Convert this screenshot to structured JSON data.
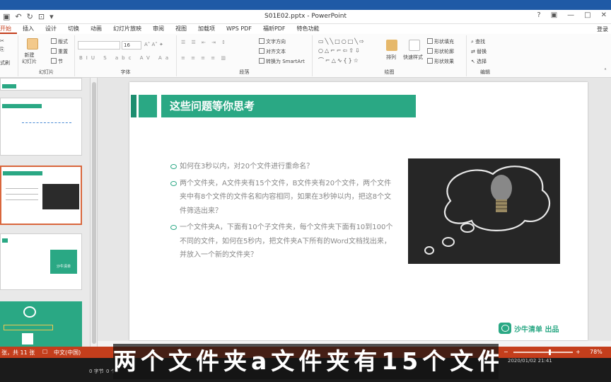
{
  "window": {
    "title": "S01E02.pptx - PowerPoint",
    "login_label": "登录"
  },
  "tabs": [
    "开始",
    "插入",
    "设计",
    "切换",
    "动画",
    "幻灯片放映",
    "审阅",
    "视图",
    "加载项",
    "WPS PDF",
    "福昕PDF",
    "特色功能"
  ],
  "ribbon": {
    "clipboard": {
      "cut": "剪切",
      "copy": "复制",
      "format": "格式刷"
    },
    "slides_group_label": "幻灯片",
    "new_slide_label": "新建\n幻灯片",
    "layout": "版式",
    "reset": "重置",
    "section": "节",
    "font_group_label": "字体",
    "font_size": "16",
    "para_group_label": "段落",
    "text_direction": "文字方向",
    "align_text": "对齐文本",
    "convert_smartart": "转换为 SmartArt",
    "drawing_group_label": "绘图",
    "arrange": "排列",
    "quick_styles": "快速样式",
    "shape_fill": "形状填充",
    "shape_outline": "形状轮廓",
    "shape_effects": "形状效果",
    "edit_group_label": "编辑",
    "find": "查找",
    "replace": "替换",
    "select": "选择"
  },
  "slide": {
    "title": "这些问题等你思考",
    "bullets": [
      "如何在3秒以内，对20个文件进行重命名？",
      "两个文件夹，A文件夹有15个文件，B文件夹有20个文件，两个文件夹中有8个文件的文件名和内容相同，如果在3秒钟以内，把这8个文件筛选出来？",
      "一个文件夹A，下面有10个子文件夹，每个文件夹下面有10到100个不同的文件，如何在5秒内，把文件夹A下所有的Word文档找出来，并放入一个新的文件夹？"
    ],
    "brand": "沙牛清单 出品"
  },
  "thumbnails": {
    "thumb4_label": "沙牛清单"
  },
  "statusbar": {
    "slide_count": "张，共 11 张",
    "language": "中文(中国)",
    "zoom": "78%",
    "zoom_fraction": 0.62
  },
  "taskbar": {
    "text1": "0 字节",
    "text2": "0 个",
    "datetime": "2020/01/02 21:41"
  },
  "subtitle": "两个文件夹a文件夹有15个文件",
  "colors": {
    "accent": "#2aa884",
    "status": "#c43e1c"
  }
}
